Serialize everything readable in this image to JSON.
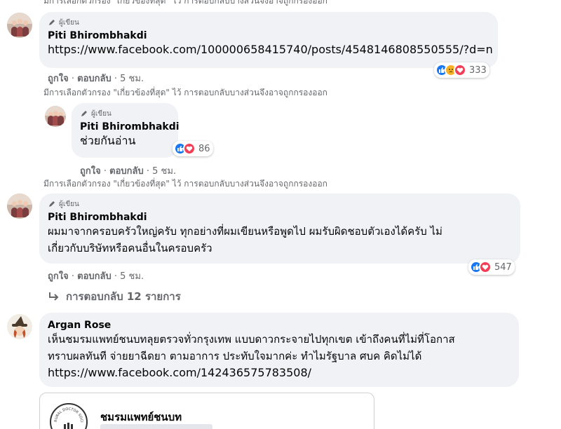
{
  "filter_notice": "มีการเลือกตัวกรอง \"เกี่ยวข้องที่สุด\" ไว้ การตอบกลับบางส่วนจึงอาจถูกกรองออก",
  "author_badge": "ผู้เขียน",
  "action_like": "ถูกใจ",
  "action_reply": "ตอบกลับ",
  "separator": "·",
  "comments": [
    {
      "author": "Piti Bhirombhakdi",
      "link": "https://www.facebook.com/100000658415740/posts/4548146808550555/?d=n",
      "time": "5 ชม.",
      "reactions": [
        "like-icon",
        "sad-icon",
        "love-icon"
      ],
      "reaction_count": "333"
    },
    {
      "author": "Piti Bhirombhakdi",
      "text": "ช่วยกันอ่าน",
      "time": "5 ชม.",
      "reactions": [
        "like-icon",
        "love-icon"
      ],
      "reaction_count": "86"
    },
    {
      "author": "Piti Bhirombhakdi",
      "text_line1": "ผมมาจากครอบครัวใหญ่ครับ ทุกอย่างที่ผมเขียนหรือพูดไป ผมรับผิดชอบตัวเองได้ครับ ไม่",
      "text_line2": "เกี่ยวกับบริษัทหรือคนอื่นในครอบครัว",
      "time": "5 ชม.",
      "reactions": [
        "like-icon",
        "love-icon"
      ],
      "reaction_count": "547",
      "replies_label": "การตอบกลับ 12 รายการ"
    },
    {
      "author": "Argan Rose",
      "text_line1": "เห็นชมรมแพทย์ชนบทลุยตรวจทั่วกรุงเทพ แบบดาวกระจายไปทุกเขต เข้าถึงคนที่ไม่ที่โอกาส",
      "text_line2": "ทราบผลทันที จ่ายยาฉีดยา ตามอาการ ประทับใจมากค่ะ ทำไมรัฐบาล ศบค คิดไม่ได้",
      "link": "https://www.facebook.com/142436575783508/",
      "card_title": "ชมรมแพทย์ชนบท",
      "card_logo_text": "RURAL DOCTOR SOCIETY"
    }
  ],
  "colors": {
    "bubble": "#f0f2f5",
    "muted": "#65676b",
    "like": "#1877f2",
    "love": "#f33e58",
    "sad": "#f7b125"
  }
}
